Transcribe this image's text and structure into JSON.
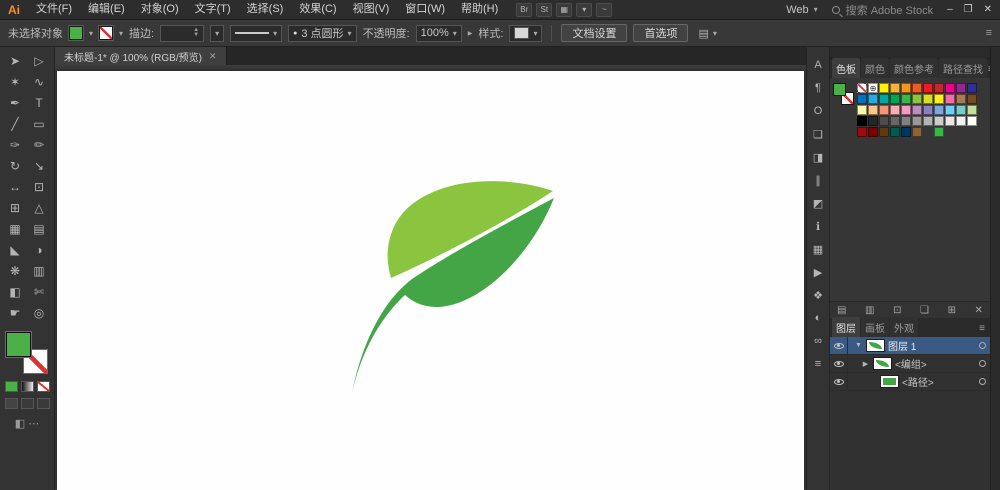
{
  "colors": {
    "fill_green": "#4CB049",
    "selection_blue": "#3A5A84",
    "logo_orange": "#FF8B1E"
  },
  "icons": {
    "chevron_down": "▾",
    "triangle_down": "▼",
    "triangle_right": "▶",
    "close": "✕",
    "panel_menu": "≡",
    "registration": "⊕",
    "brush_dot": "●",
    "stepper_up": "▲",
    "stepper_down": "▼"
  },
  "menubar": {
    "logo": "Ai",
    "menus": [
      {
        "id": "file",
        "label": "文件(F)"
      },
      {
        "id": "edit",
        "label": "编辑(E)"
      },
      {
        "id": "object",
        "label": "对象(O)"
      },
      {
        "id": "type",
        "label": "文字(T)"
      },
      {
        "id": "select",
        "label": "选择(S)"
      },
      {
        "id": "effect",
        "label": "效果(C)"
      },
      {
        "id": "view",
        "label": "视图(V)"
      },
      {
        "id": "window",
        "label": "窗口(W)"
      },
      {
        "id": "help",
        "label": "帮助(H)"
      }
    ],
    "app_icons": [
      {
        "id": "bridge-icon",
        "glyph": "Br"
      },
      {
        "id": "stock-icon",
        "glyph": "St"
      },
      {
        "id": "arrange-documents-icon",
        "glyph": "▦"
      },
      {
        "id": "arrange-documents-chevron",
        "glyph": "▾"
      },
      {
        "id": "gpu-performance-icon",
        "glyph": "~"
      }
    ],
    "workspace": "Web",
    "search_placeholder": "搜索 Adobe Stock",
    "window_buttons": [
      {
        "id": "minimize-button",
        "glyph": "–"
      },
      {
        "id": "restore-button",
        "glyph": "❐"
      },
      {
        "id": "close-button",
        "glyph": "✕"
      }
    ]
  },
  "controlbar": {
    "no_selection": "未选择对象",
    "stroke_label": "描边:",
    "brush_name": "3 点圆形",
    "opacity_label": "不透明度:",
    "opacity_value": "100%",
    "style_label": "样式:",
    "document_setup": "文档设置",
    "preferences": "首选项"
  },
  "document_tab": {
    "title": "未标题-1* @ 100% (RGB/预览)"
  },
  "toolbar": {
    "tools": [
      {
        "id": "selection-tool",
        "glyph": "➤"
      },
      {
        "id": "direct-selection-tool",
        "glyph": "▷"
      },
      {
        "id": "magic-wand-tool",
        "glyph": "✶"
      },
      {
        "id": "lasso-tool",
        "glyph": "∿"
      },
      {
        "id": "pen-tool",
        "glyph": "✒"
      },
      {
        "id": "type-tool",
        "glyph": "T"
      },
      {
        "id": "line-segment-tool",
        "glyph": "╱"
      },
      {
        "id": "rectangle-tool",
        "glyph": "▭"
      },
      {
        "id": "paintbrush-tool",
        "glyph": "✑"
      },
      {
        "id": "pencil-tool",
        "glyph": "✏"
      },
      {
        "id": "rotate-tool",
        "glyph": "↻"
      },
      {
        "id": "scale-tool",
        "glyph": "↘"
      },
      {
        "id": "width-tool",
        "glyph": "↔"
      },
      {
        "id": "free-transform-tool",
        "glyph": "⊡"
      },
      {
        "id": "shape-builder-tool",
        "glyph": "⊞"
      },
      {
        "id": "perspective-grid-tool",
        "glyph": "△"
      },
      {
        "id": "mesh-tool",
        "glyph": "▦"
      },
      {
        "id": "gradient-tool",
        "glyph": "▤"
      },
      {
        "id": "eyedropper-tool",
        "glyph": "◣"
      },
      {
        "id": "blend-tool",
        "glyph": "◑"
      },
      {
        "id": "symbol-sprayer-tool",
        "glyph": "❋"
      },
      {
        "id": "column-graph-tool",
        "glyph": "▥"
      },
      {
        "id": "artboard-tool",
        "glyph": "◧"
      },
      {
        "id": "slice-tool",
        "glyph": "✄"
      },
      {
        "id": "hand-tool",
        "glyph": "☛"
      },
      {
        "id": "zoom-tool",
        "glyph": "◎"
      }
    ]
  },
  "panel_strip": [
    {
      "id": "character-panel-icon",
      "glyph": "A"
    },
    {
      "id": "paragraph-panel-icon",
      "glyph": "¶"
    },
    {
      "id": "opentype-panel-icon",
      "glyph": "O"
    },
    {
      "id": "artboards-panel-icon",
      "glyph": "❏"
    },
    {
      "id": "transform-panel-icon",
      "glyph": "◨"
    },
    {
      "id": "align-panel-icon",
      "glyph": "∥"
    },
    {
      "id": "pathfinder-panel-icon",
      "glyph": "◩"
    },
    {
      "id": "info-panel-icon",
      "glyph": "ℹ"
    },
    {
      "id": "transparency-panel-icon",
      "glyph": "▦"
    },
    {
      "id": "actions-panel-icon",
      "glyph": "▶"
    },
    {
      "id": "graphic-styles-panel-icon",
      "glyph": "❖"
    },
    {
      "id": "appearance-panel-icon",
      "glyph": "◐"
    },
    {
      "id": "symbols-panel-icon",
      "glyph": "∞"
    },
    {
      "id": "stroke-panel-icon",
      "glyph": "≡"
    }
  ],
  "swatches_panel": {
    "tabs": [
      "色板",
      "颜色",
      "颜色参考",
      "路径查找"
    ],
    "active_index": 0,
    "grid": [
      [
        "none",
        "reg",
        "#FFF200",
        "#FBB03B",
        "#F7941E",
        "#F15A24",
        "#ED1C24",
        "#C1272D",
        "#EC008C",
        "#92278F",
        "#2E3192"
      ],
      [
        "#0071BC",
        "#29ABE2",
        "#00A99D",
        "#00A651",
        "#39B54A",
        "#8CC63F",
        "#D9E021",
        "#FCEE21",
        "#F06EAA",
        "#A67C52",
        "#754C24"
      ],
      [
        "#FFF9AE",
        "#FDC689",
        "#F69679",
        "#F9ADB5",
        "#F49AC1",
        "#BD8CBF",
        "#8781BD",
        "#7DA7D9",
        "#6DCFF6",
        "#7ACCC8",
        "#C4DF9B"
      ],
      [
        "#000000",
        "#262626",
        "#4D4D4D",
        "#666666",
        "#808080",
        "#999999",
        "#B3B3B3",
        "#CCCCCC",
        "#E6E6E6",
        "#F2F2F2",
        "#FFFFFF"
      ],
      [
        "#9E0B0F",
        "#790000",
        "#603913",
        "#005952",
        "#003663",
        "#8C6239",
        "",
        "#39B54A",
        "",
        "",
        ""
      ]
    ],
    "actions": [
      {
        "id": "swatch-libraries-menu-button",
        "glyph": "▤"
      },
      {
        "id": "swatch-kinds-menu-button",
        "glyph": "▥"
      },
      {
        "id": "swatch-options-button",
        "glyph": "⊡"
      },
      {
        "id": "new-color-group-button",
        "glyph": "❏"
      },
      {
        "id": "new-swatch-button",
        "glyph": "⊞"
      },
      {
        "id": "delete-swatch-button",
        "glyph": "✕"
      }
    ]
  },
  "layers_panel": {
    "tabs": [
      "图层",
      "画板",
      "外观"
    ],
    "active_index": 0,
    "rows": [
      {
        "label": "图层 1",
        "selected": true,
        "expand": true,
        "thumb": "leaf",
        "indent": 0
      },
      {
        "label": "<编组>",
        "selected": false,
        "expand": false,
        "thumb": "leaf",
        "indent": 1
      },
      {
        "label": "<路径>",
        "selected": false,
        "expand": null,
        "thumb": "square",
        "indent": 2
      }
    ]
  },
  "artwork": {
    "leaf_top_color": "#8BC53F",
    "leaf_bottom_color": "#44A547"
  }
}
